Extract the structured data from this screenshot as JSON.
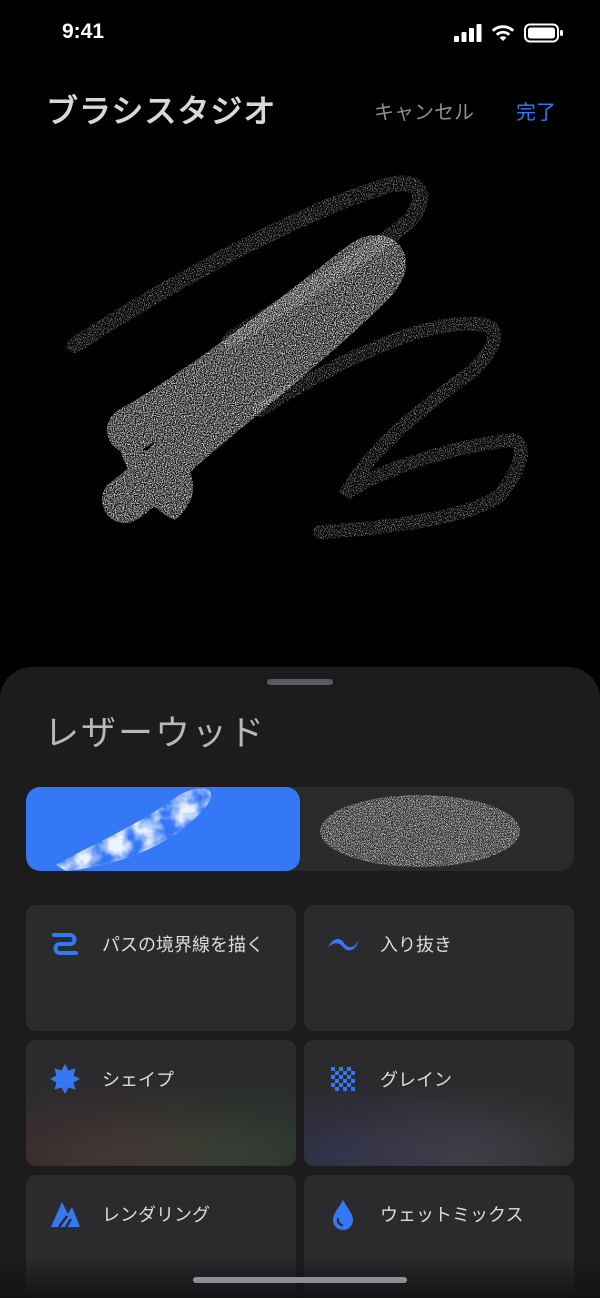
{
  "status_bar": {
    "time": "9:41",
    "icons": [
      "signal-icon",
      "wifi-icon",
      "battery-icon"
    ]
  },
  "header": {
    "title": "ブラシスタジオ",
    "cancel_label": "キャンセル",
    "done_label": "完了"
  },
  "colors": {
    "accent": "#3478f6",
    "sheet_bg": "#1c1c1e",
    "card_bg": "#2b2b2d"
  },
  "sheet": {
    "brush_name": "レザーウッド",
    "preview_options": [
      {
        "name": "shape-preview",
        "selected": true
      },
      {
        "name": "grain-preview",
        "selected": false
      }
    ],
    "cards": [
      {
        "icon": "path-icon",
        "label": "パスの境界線を描く"
      },
      {
        "icon": "wave-icon",
        "label": "入り抜き"
      },
      {
        "icon": "shape-burst-icon",
        "label": "シェイプ"
      },
      {
        "icon": "grain-checker-icon",
        "label": "グレイン"
      },
      {
        "icon": "rendering-icon",
        "label": "レンダリング"
      },
      {
        "icon": "water-drop-icon",
        "label": "ウェットミックス"
      }
    ]
  }
}
